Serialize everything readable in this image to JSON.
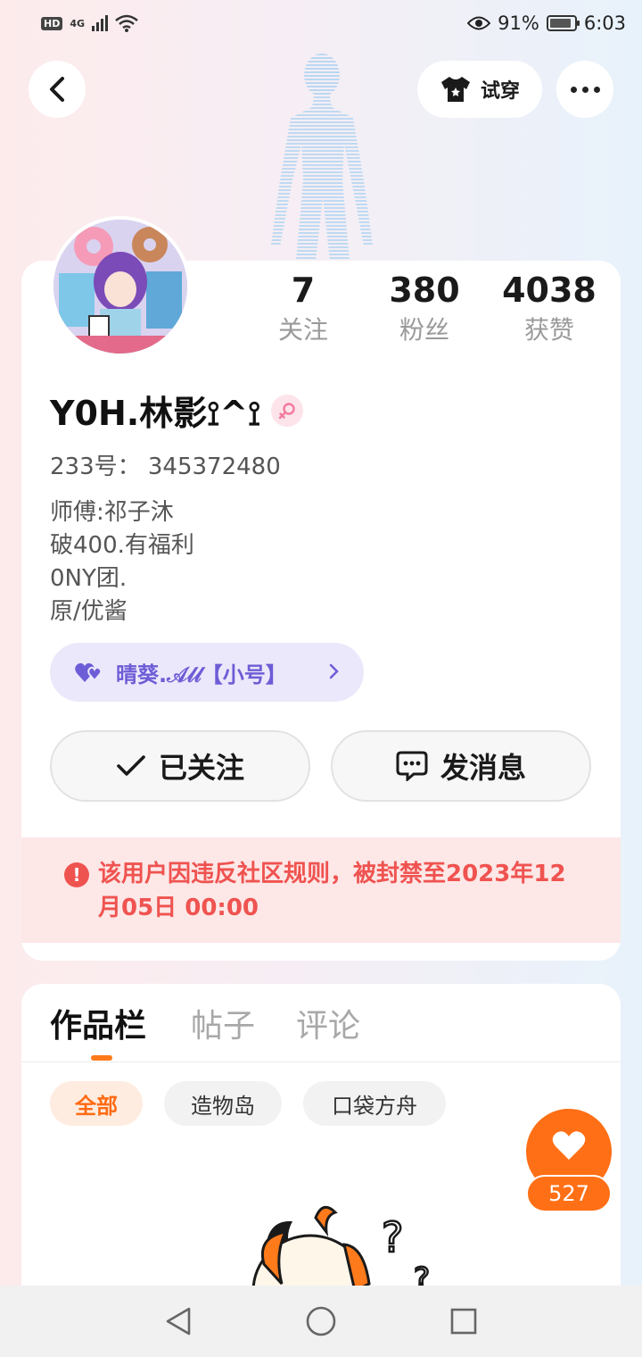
{
  "status_bar": {
    "hd": "HD",
    "network": "4G",
    "battery_percent": "91%",
    "time": "6:03",
    "battery_level": 0.91
  },
  "header": {
    "back_icon": "chevron-left-icon",
    "try_on_label": "试穿",
    "try_on_icon": "tshirt-icon",
    "more_icon": "more-dots-icon"
  },
  "profile": {
    "stats": [
      {
        "num": "7",
        "label": "关注"
      },
      {
        "num": "380",
        "label": "粉丝"
      },
      {
        "num": "4038",
        "label": "获赞"
      }
    ],
    "username": "Y0H.林影⟟^⟟",
    "gender_icon": "female-icon",
    "uid": "233号： 345372480",
    "bio": [
      "师傅:祁子沐",
      "破400.有福利",
      "0NY团.",
      "原/优酱"
    ],
    "related_account": "晴葵.𝒜𝓁𝓁【小号】",
    "follow_button": "已关注",
    "message_button": "发消息",
    "ban_notice": "该用户因违反社区规则，被封禁至2023年12月05日 00:00"
  },
  "tabs": [
    {
      "label": "作品栏",
      "active": true
    },
    {
      "label": "帖子",
      "active": false
    },
    {
      "label": "评论",
      "active": false
    }
  ],
  "filters": [
    {
      "label": "全部",
      "active": true
    },
    {
      "label": "造物岛",
      "active": false
    },
    {
      "label": "口袋方舟",
      "active": false
    }
  ],
  "like": {
    "count": "527"
  },
  "colors": {
    "accent_orange": "#ff6f15",
    "ban_red": "#ef5350",
    "related_purple": "#6d5dd6"
  }
}
